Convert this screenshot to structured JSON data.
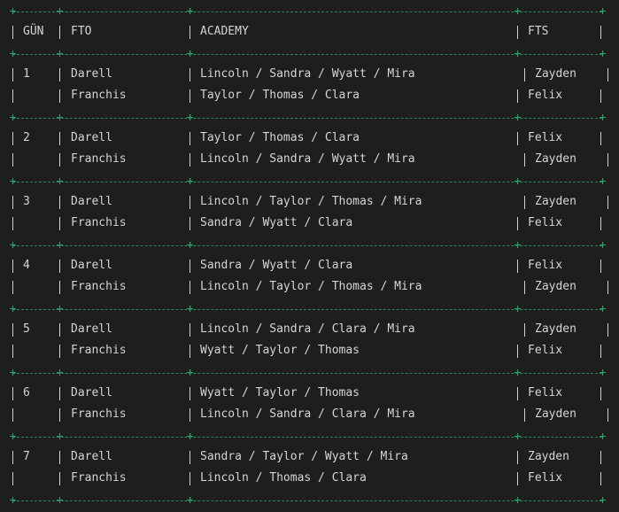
{
  "header": {
    "day": "GÜN",
    "fto": "FTO",
    "academy": "ACADEMY",
    "fts": "FTS"
  },
  "days": [
    {
      "day": "1",
      "rows": [
        {
          "fto": "Darell",
          "academy": "Lincoln / Sandra / Wyatt / Mira",
          "fts": "Zayden"
        },
        {
          "fto": "Franchis",
          "academy": "Taylor / Thomas / Clara",
          "fts": "Felix"
        }
      ]
    },
    {
      "day": "2",
      "rows": [
        {
          "fto": "Darell",
          "academy": "Taylor / Thomas / Clara",
          "fts": "Felix"
        },
        {
          "fto": "Franchis",
          "academy": "Lincoln / Sandra / Wyatt / Mira",
          "fts": "Zayden"
        }
      ]
    },
    {
      "day": "3",
      "rows": [
        {
          "fto": "Darell",
          "academy": "Lincoln / Taylor / Thomas / Mira",
          "fts": "Zayden"
        },
        {
          "fto": "Franchis",
          "academy": "Sandra / Wyatt / Clara",
          "fts": "Felix"
        }
      ]
    },
    {
      "day": "4",
      "rows": [
        {
          "fto": "Darell",
          "academy": "Sandra / Wyatt / Clara",
          "fts": "Felix"
        },
        {
          "fto": "Franchis",
          "academy": "Lincoln / Taylor / Thomas / Mira",
          "fts": "Zayden"
        }
      ]
    },
    {
      "day": "5",
      "rows": [
        {
          "fto": "Darell",
          "academy": "Lincoln / Sandra / Clara / Mira",
          "fts": "Zayden"
        },
        {
          "fto": "Franchis",
          "academy": "Wyatt / Taylor / Thomas",
          "fts": "Felix"
        }
      ]
    },
    {
      "day": "6",
      "rows": [
        {
          "fto": "Darell",
          "academy": "Wyatt / Taylor / Thomas",
          "fts": "Felix"
        },
        {
          "fto": "Franchis",
          "academy": "Lincoln / Sandra / Clara / Mira",
          "fts": "Zayden"
        }
      ]
    },
    {
      "day": "7",
      "rows": [
        {
          "fto": "Darell",
          "academy": "Sandra / Taylor / Wyatt / Mira",
          "fts": "Zayden"
        },
        {
          "fto": "Franchis",
          "academy": "Lincoln / Thomas / Clara",
          "fts": "Felix"
        }
      ]
    }
  ]
}
